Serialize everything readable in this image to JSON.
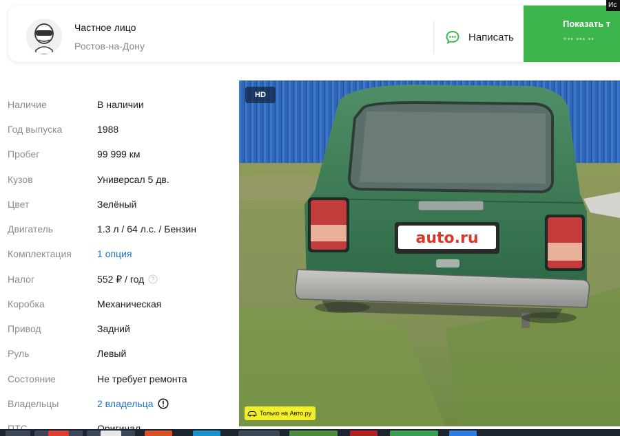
{
  "seller": {
    "name": "Частное лицо",
    "city": "Ростов-на-Дону",
    "write_label": "Написать",
    "show_phone_label": "Показать т",
    "phone_mask": "+•• ••• ••",
    "corner_tag": "Ис"
  },
  "specs": [
    {
      "label": "Наличие",
      "value": "В наличии"
    },
    {
      "label": "Год выпуска",
      "value": "1988"
    },
    {
      "label": "Пробег",
      "value": "99 999 км"
    },
    {
      "label": "Кузов",
      "value": "Универсал 5 дв."
    },
    {
      "label": "Цвет",
      "value": "Зелёный"
    },
    {
      "label": "Двигатель",
      "value": "1.3 л / 64 л.с. / Бензин"
    },
    {
      "label": "Комплектация",
      "value": "1 опция"
    },
    {
      "label": "Налог",
      "value": "552 ₽ / год"
    },
    {
      "label": "Коробка",
      "value": "Механическая"
    },
    {
      "label": "Привод",
      "value": "Задний"
    },
    {
      "label": "Руль",
      "value": "Левый"
    },
    {
      "label": "Состояние",
      "value": "Не требует ремонта"
    },
    {
      "label": "Владельцы",
      "value": "2 владельца"
    },
    {
      "label": "ПТС",
      "value": "Оригинал"
    }
  ],
  "photo": {
    "hd_badge": "HD",
    "only_badge": "Только на Авто.ру",
    "plate_text": "auto.ru"
  },
  "icons": {
    "avatar": "anonymous-driver-helmet-icon",
    "write": "chat-bubble-icon",
    "tax_help": "question-circle-icon",
    "owners_info": "exclamation-circle-icon",
    "only_badge": "car-outline-icon"
  },
  "colors": {
    "green_accent": "#3cb64c",
    "link_blue": "#1f6fd6",
    "label_gray": "#8c8c8c",
    "badge_yellow": "#f3ee2a"
  }
}
